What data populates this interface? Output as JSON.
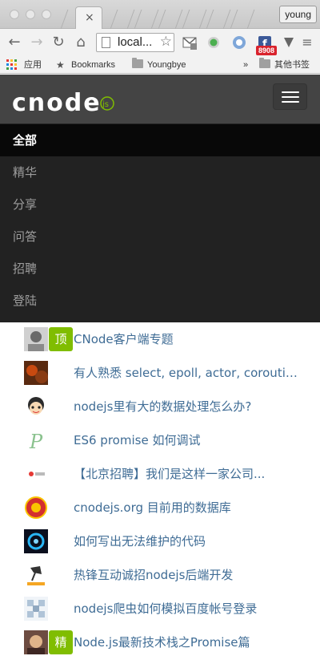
{
  "browser": {
    "tab_close": "×",
    "profile_name": "young",
    "address": "local...",
    "extension_badge": "8908",
    "bookmarks": {
      "apps_label": "应用",
      "bookmarks_label": "Bookmarks",
      "folder_label": "Youngbye",
      "overflow_label": "»",
      "other_label": "其他书签"
    }
  },
  "site": {
    "logo_text": "cnode",
    "logo_suffix": "js",
    "menu": [
      {
        "label": "全部",
        "active": true
      },
      {
        "label": "精华",
        "active": false
      },
      {
        "label": "分享",
        "active": false
      },
      {
        "label": "问答",
        "active": false
      },
      {
        "label": "招聘",
        "active": false
      },
      {
        "label": "登陆",
        "active": false
      }
    ]
  },
  "topics": [
    {
      "title": "CNode客户端专题",
      "tag": "顶"
    },
    {
      "title": "有人熟悉 select, epoll, actor, coroutine...",
      "tag": ""
    },
    {
      "title": "nodejs里有大的数据处理怎么办?",
      "tag": ""
    },
    {
      "title": "ES6 promise 如何调试",
      "tag": ""
    },
    {
      "title": "【北京招聘】我们是这样一家公司...",
      "tag": ""
    },
    {
      "title": "cnodejs.org 目前用的数据库",
      "tag": ""
    },
    {
      "title": "如何写出无法维护的代码",
      "tag": ""
    },
    {
      "title": "热锋互动诚招nodejs后端开发",
      "tag": ""
    },
    {
      "title": "nodejs爬虫如何模拟百度帐号登录",
      "tag": ""
    },
    {
      "title": "Node.js最新技术栈之Promise篇",
      "tag": "精"
    }
  ],
  "colors": {
    "brand_green": "#80bd01",
    "nav_bg": "#444444",
    "menu_bg": "#222222",
    "link": "#3f6c95"
  }
}
